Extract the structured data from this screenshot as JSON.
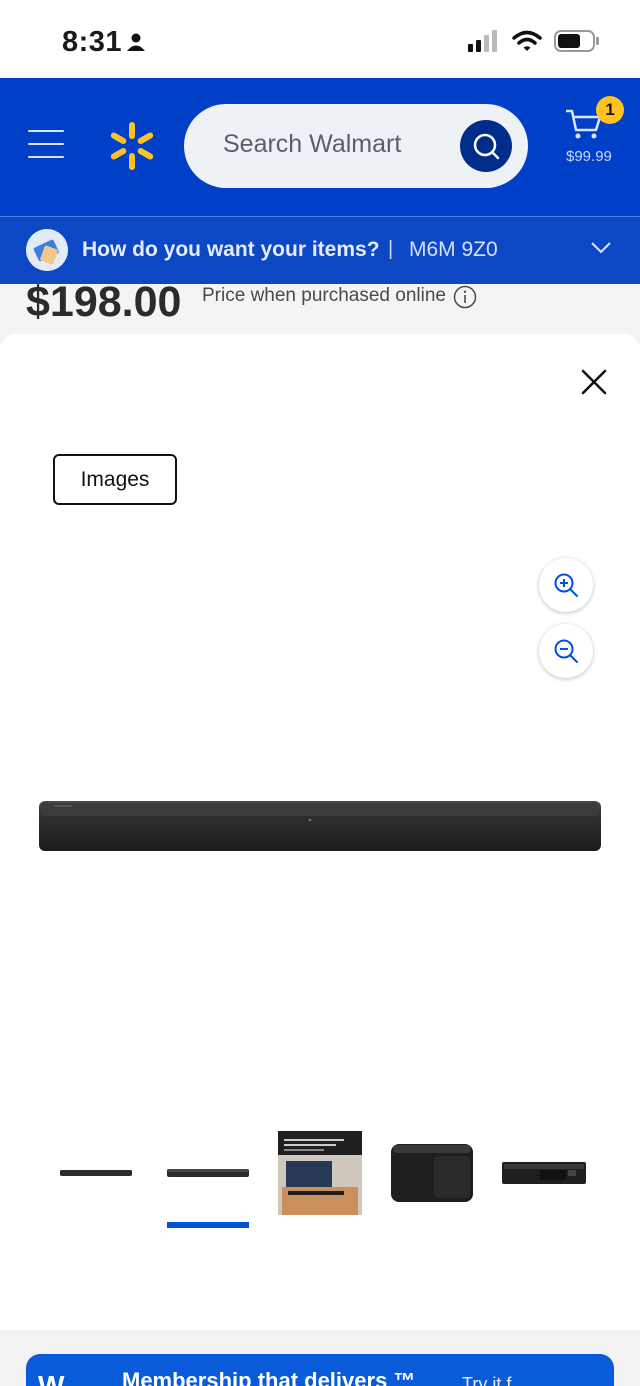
{
  "status_bar": {
    "time": "8:31"
  },
  "header": {
    "search_placeholder": "Search Walmart",
    "cart": {
      "count": "1",
      "total": "$99.99"
    },
    "colors": {
      "brand_blue": "#0040c8",
      "spark_yellow": "#ffc220"
    }
  },
  "delivery": {
    "question": "How do you want your items?",
    "separator": "|",
    "postal_code": "M6M 9Z0"
  },
  "product": {
    "price": "$198.00",
    "price_note": "Price when purchased online"
  },
  "gallery": {
    "tab_label": "Images",
    "thumbnails": [
      {
        "name": "soundbar-front"
      },
      {
        "name": "soundbar-angle",
        "selected": true
      },
      {
        "name": "soundbar-lifestyle"
      },
      {
        "name": "subwoofer"
      },
      {
        "name": "soundbar-rear-ports"
      }
    ],
    "active_color": "#0052d9"
  },
  "membership": {
    "text": "Membership that delivers ™",
    "try_it": "Try it f"
  }
}
